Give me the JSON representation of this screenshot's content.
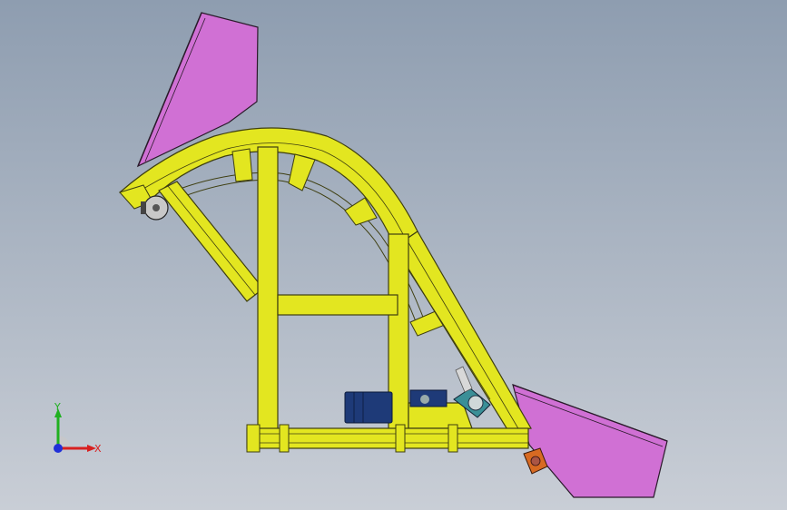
{
  "viewport": {
    "background_top": "#8e9db0",
    "background_bottom": "#c9ced6"
  },
  "model": {
    "colors": {
      "frame": "#e3e620",
      "frame_edge": "#3e3e10",
      "hopper": "#d070d4",
      "hopper_edge": "#2a1a2a",
      "motor": "#1e3a78",
      "gearbox": "#3a8f97",
      "sensor": "#d8d8d8",
      "drive_orange": "#d76a22",
      "pulley": "#c8c8c8"
    }
  },
  "triad": {
    "x_label": "X",
    "y_label": "Y",
    "x_color": "#d82020",
    "y_color": "#20b020",
    "z_color": "#2030d8"
  }
}
